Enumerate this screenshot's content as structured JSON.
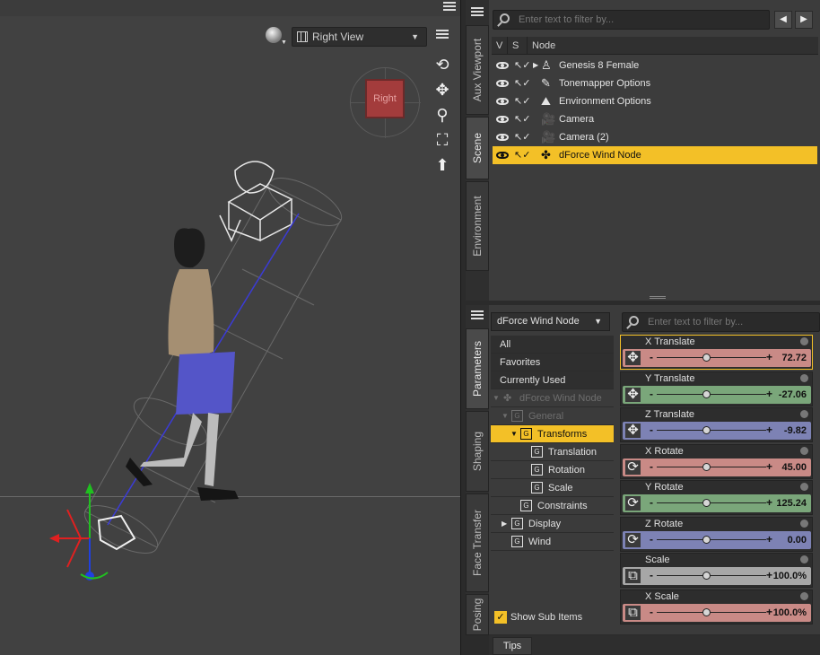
{
  "viewport": {
    "view_dropdown": "Right View",
    "cube_label": "Right",
    "icons": [
      "render-preview-sphere-icon",
      "orbit-icon",
      "pan-icon",
      "zoom-icon",
      "frame-icon",
      "reset-view-icon"
    ]
  },
  "side_tabs_top": [
    "Aux Viewport",
    "Scene",
    "Environment"
  ],
  "side_tabs_bottom": [
    "Parameters",
    "Shaping",
    "Face Transfer",
    "Posing"
  ],
  "scene": {
    "filter_placeholder": "Enter text to filter by...",
    "columns": {
      "v": "V",
      "s": "S",
      "node": "Node"
    },
    "nodes": [
      {
        "label": "Genesis 8 Female",
        "icon": "figure-icon",
        "expandable": true,
        "selected": false
      },
      {
        "label": "Tonemapper Options",
        "icon": "tonemapper-icon",
        "expandable": false,
        "selected": false
      },
      {
        "label": "Environment Options",
        "icon": "environment-icon",
        "expandable": false,
        "selected": false
      },
      {
        "label": "Camera",
        "icon": "camera-icon",
        "expandable": false,
        "selected": false
      },
      {
        "label": "Camera (2)",
        "icon": "camera-icon",
        "expandable": false,
        "selected": false
      },
      {
        "label": "dForce Wind Node",
        "icon": "wind-node-icon",
        "expandable": false,
        "selected": true
      }
    ]
  },
  "parameters": {
    "node_dropdown": "dForce Wind Node",
    "filter_placeholder": "Enter text to filter by...",
    "categories": [
      "All",
      "Favorites",
      "Currently Used"
    ],
    "tree": {
      "root": "dForce Wind Node",
      "general": "General",
      "transforms": "Transforms",
      "translation": "Translation",
      "rotation": "Rotation",
      "scale": "Scale",
      "constraints": "Constraints",
      "display": "Display",
      "wind": "Wind"
    },
    "show_sub_items": "Show Sub Items",
    "show_sub_items_checked": true,
    "sliders": [
      {
        "name": "X Translate",
        "value": "72.72",
        "color": "#c98a86",
        "knob": 0.46,
        "selected": true
      },
      {
        "name": "Y Translate",
        "value": "-27.06",
        "color": "#7aa67a",
        "knob": 0.46,
        "selected": false
      },
      {
        "name": "Z Translate",
        "value": "-9.82",
        "color": "#7d82b4",
        "knob": 0.46,
        "selected": false
      },
      {
        "name": "X Rotate",
        "value": "45.00",
        "color": "#c98a86",
        "knob": 0.46,
        "selected": false
      },
      {
        "name": "Y Rotate",
        "value": "125.24",
        "color": "#7aa67a",
        "knob": 0.46,
        "selected": false
      },
      {
        "name": "Z Rotate",
        "value": "0.00",
        "color": "#7d82b4",
        "knob": 0.46,
        "selected": false
      },
      {
        "name": "Scale",
        "value": "100.0%",
        "color": "#a7a7a7",
        "knob": 0.46,
        "selected": false
      },
      {
        "name": "X Scale",
        "value": "100.0%",
        "color": "#c98a86",
        "knob": 0.46,
        "selected": false
      }
    ]
  },
  "tips": "Tips"
}
